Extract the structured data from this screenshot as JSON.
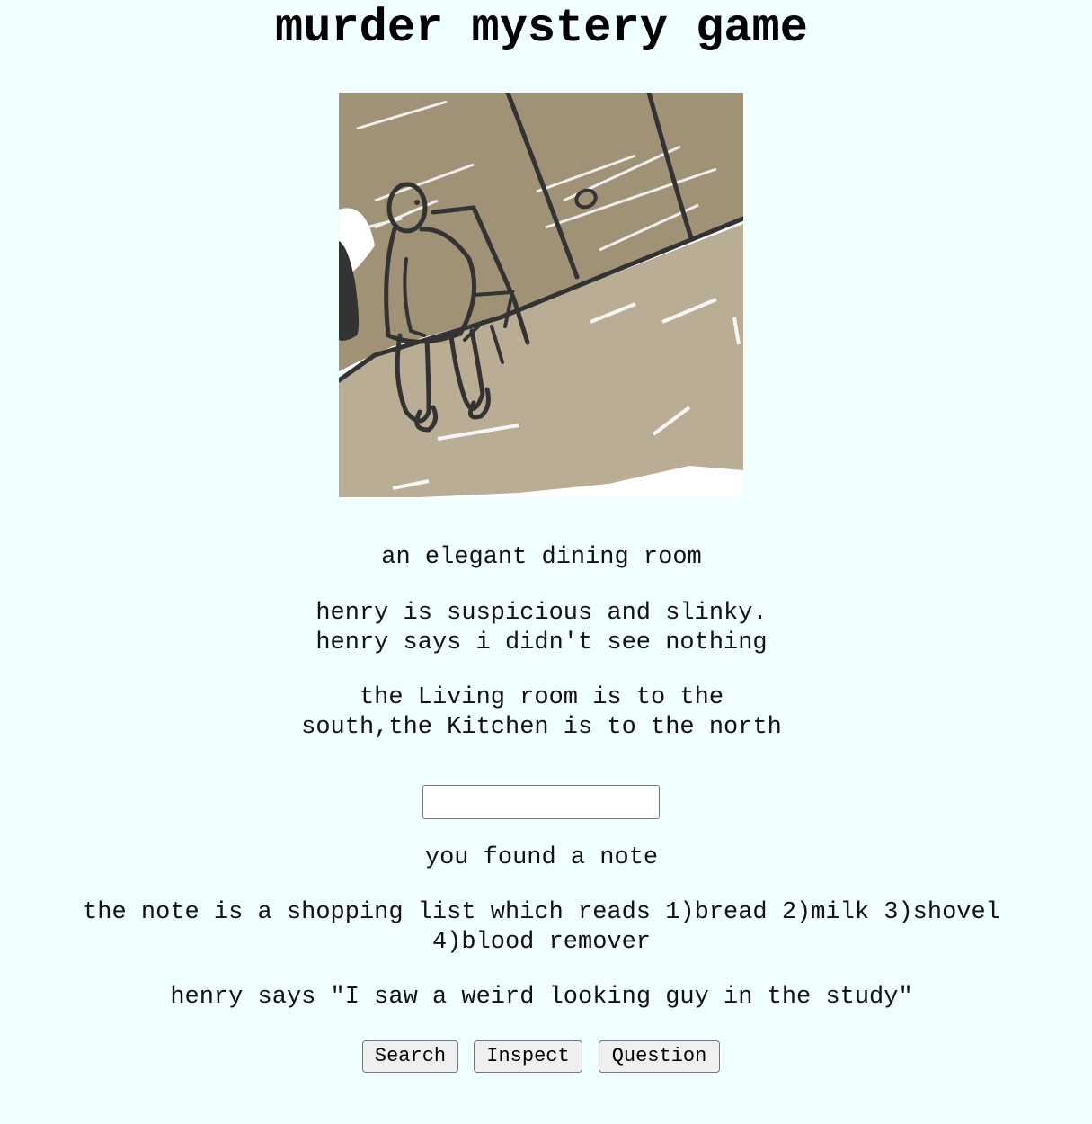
{
  "game": {
    "title": "murder mystery game"
  },
  "scene": {
    "location": "an elegant dining room",
    "character_description": "henry is suspicious and slinky.",
    "character_says": "henry says i didn't see nothing",
    "exits": "the Living room is to the\nsouth,the Kitchen is to the north"
  },
  "command": {
    "value": "",
    "placeholder": ""
  },
  "log": {
    "found": "you found a note",
    "note_text": "the note is a shopping list which reads 1)bread 2)milk 3)shovel\n4)blood remover",
    "dialogue": "henry says \"I saw a weird looking guy in the study\""
  },
  "actions": {
    "search": "Search",
    "inspect": "Inspect",
    "question": "Question"
  },
  "colors": {
    "background": "#f0ffff",
    "wall": "#a09277",
    "floor": "#baad95",
    "ink": "#333333"
  }
}
